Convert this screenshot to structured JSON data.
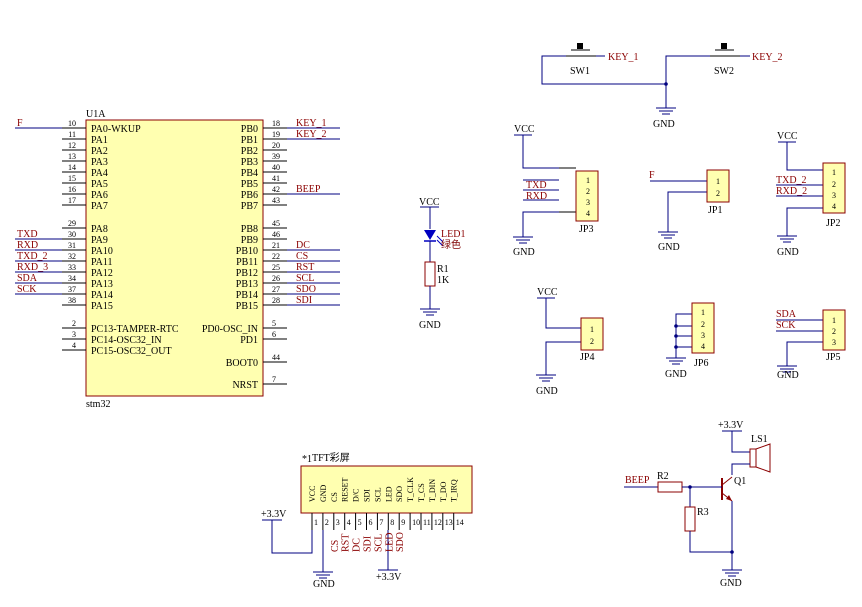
{
  "mcu": {
    "designator": "U1A",
    "part": "stm32",
    "left_pins": [
      {
        "num": "10",
        "name": "PA0-WKUP",
        "net": "F"
      },
      {
        "num": "11",
        "name": "PA1",
        "net": ""
      },
      {
        "num": "12",
        "name": "PA2",
        "net": ""
      },
      {
        "num": "13",
        "name": "PA3",
        "net": ""
      },
      {
        "num": "14",
        "name": "PA4",
        "net": ""
      },
      {
        "num": "15",
        "name": "PA5",
        "net": ""
      },
      {
        "num": "16",
        "name": "PA6",
        "net": ""
      },
      {
        "num": "17",
        "name": "PA7",
        "net": ""
      },
      {
        "num": "29",
        "name": "PA8",
        "net": ""
      },
      {
        "num": "30",
        "name": "PA9",
        "net": "TXD"
      },
      {
        "num": "31",
        "name": "PA10",
        "net": "RXD"
      },
      {
        "num": "32",
        "name": "PA11",
        "net": "TXD_2"
      },
      {
        "num": "33",
        "name": "PA12",
        "net": "RXD_3"
      },
      {
        "num": "34",
        "name": "PA13",
        "net": "SDA"
      },
      {
        "num": "37",
        "name": "PA14",
        "net": "SCK"
      },
      {
        "num": "38",
        "name": "PA15",
        "net": ""
      },
      {
        "num": "2",
        "name": "PC13-TAMPER-RTC",
        "net": ""
      },
      {
        "num": "3",
        "name": "PC14-OSC32_IN",
        "net": ""
      },
      {
        "num": "4",
        "name": "PC15-OSC32_OUT",
        "net": ""
      }
    ],
    "right_pins": [
      {
        "num": "18",
        "name": "PB0",
        "net": "KEY_1"
      },
      {
        "num": "19",
        "name": "PB1",
        "net": "KEY_2"
      },
      {
        "num": "20",
        "name": "PB2",
        "net": ""
      },
      {
        "num": "39",
        "name": "PB3",
        "net": ""
      },
      {
        "num": "40",
        "name": "PB4",
        "net": ""
      },
      {
        "num": "41",
        "name": "PB5",
        "net": ""
      },
      {
        "num": "42",
        "name": "PB6",
        "net": "BEEP"
      },
      {
        "num": "43",
        "name": "PB7",
        "net": ""
      },
      {
        "num": "45",
        "name": "PB8",
        "net": ""
      },
      {
        "num": "46",
        "name": "PB9",
        "net": ""
      },
      {
        "num": "21",
        "name": "PB10",
        "net": "DC"
      },
      {
        "num": "22",
        "name": "PB11",
        "net": "CS"
      },
      {
        "num": "25",
        "name": "PB12",
        "net": "RST"
      },
      {
        "num": "26",
        "name": "PB13",
        "net": "SCL"
      },
      {
        "num": "27",
        "name": "PB14",
        "net": "SDO"
      },
      {
        "num": "28",
        "name": "PB15",
        "net": "SDI"
      },
      {
        "num": "5",
        "name": "PD0-OSC_IN",
        "net": ""
      },
      {
        "num": "6",
        "name": "PD1",
        "net": ""
      },
      {
        "num": "44",
        "name": "BOOT0",
        "net": ""
      },
      {
        "num": "7",
        "name": "NRST",
        "net": ""
      }
    ]
  },
  "switches": {
    "sw1": "SW1",
    "sw2": "SW2",
    "key1": "KEY_1",
    "key2": "KEY_2",
    "gnd": "GND"
  },
  "led_section": {
    "vcc": "VCC",
    "led": "LED1",
    "led_color": "绿色",
    "resistor": "R1",
    "resistor_value": "1K",
    "gnd": "GND"
  },
  "connectors": {
    "jp3": {
      "label": "JP3",
      "vcc": "VCC",
      "gnd": "GND",
      "pins": [
        "1",
        "2",
        "3",
        "4"
      ],
      "nets": [
        "TXD",
        "RXD"
      ]
    },
    "jp1": {
      "label": "JP1",
      "gnd": "GND",
      "pins": [
        "1",
        "2"
      ],
      "net": "F"
    },
    "jp2": {
      "label": "JP2",
      "vcc": "VCC",
      "gnd": "GND",
      "pins": [
        "1",
        "2",
        "3",
        "4"
      ],
      "nets": [
        "TXD_2",
        "RXD_2"
      ]
    },
    "jp4": {
      "label": "JP4",
      "vcc": "VCC",
      "gnd": "GND",
      "pins": [
        "1",
        "2"
      ]
    },
    "jp6": {
      "label": "JP6",
      "gnd": "GND",
      "pins": [
        "1",
        "2",
        "3",
        "4"
      ]
    },
    "jp5": {
      "label": "JP5",
      "gnd": "GND",
      "pins": [
        "1",
        "2",
        "3"
      ],
      "nets": [
        "SDA",
        "SCK"
      ]
    }
  },
  "buzzer": {
    "v33": "+3.3V",
    "ls": "LS1",
    "q": "Q1",
    "r2": "R2",
    "r3": "R3",
    "beep": "BEEP",
    "gnd": "GND"
  },
  "tft": {
    "designator": "*1",
    "title": "TFT彩屏",
    "pin_names": [
      "VCC",
      "GND",
      "CS",
      "RESET",
      "D/C",
      "SDI",
      "SCL",
      "LED",
      "SDO",
      "T_CLK",
      "T_CS",
      "T_DIN",
      "T_DO",
      "T_IRQ"
    ],
    "pin_nums": [
      "1",
      "2",
      "3",
      "4",
      "5",
      "6",
      "7",
      "8",
      "9",
      "10",
      "11",
      "12",
      "13",
      "14"
    ],
    "nets": [
      "CS",
      "RST",
      "DC",
      "SDI",
      "SCL",
      "LED",
      "SDO"
    ],
    "v33_left": "+3.3V",
    "v33_bottom": "+3.3V",
    "gnd": "GND"
  },
  "colors": {
    "wire": "#000080",
    "component": "#8b0000",
    "chip_fill": "#ffffb0",
    "led_blue": "#0000c0"
  }
}
